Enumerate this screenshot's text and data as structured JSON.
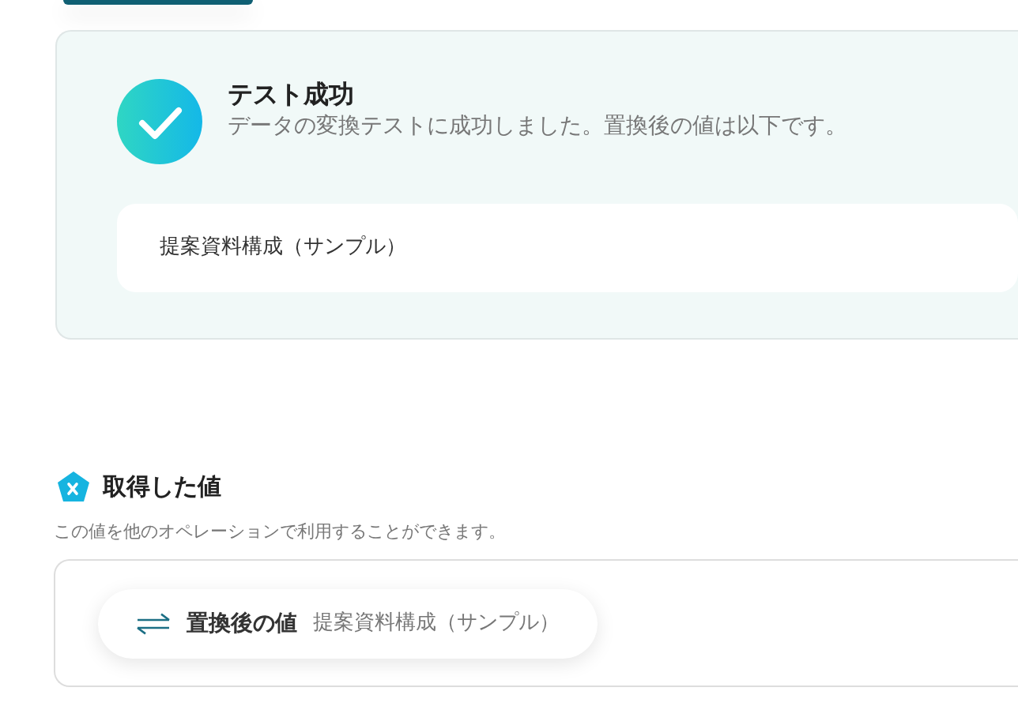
{
  "test_result": {
    "title": "テスト成功",
    "message": "データの変換テストに成功しました。置換後の値は以下です。",
    "result_value": "提案資料構成（サンプル）"
  },
  "output_section": {
    "title": "取得した値",
    "description": "この値を他のオペレーションで利用することができます。",
    "values": [
      {
        "label": "置換後の値",
        "value": "提案資料構成（サンプル）"
      }
    ]
  }
}
